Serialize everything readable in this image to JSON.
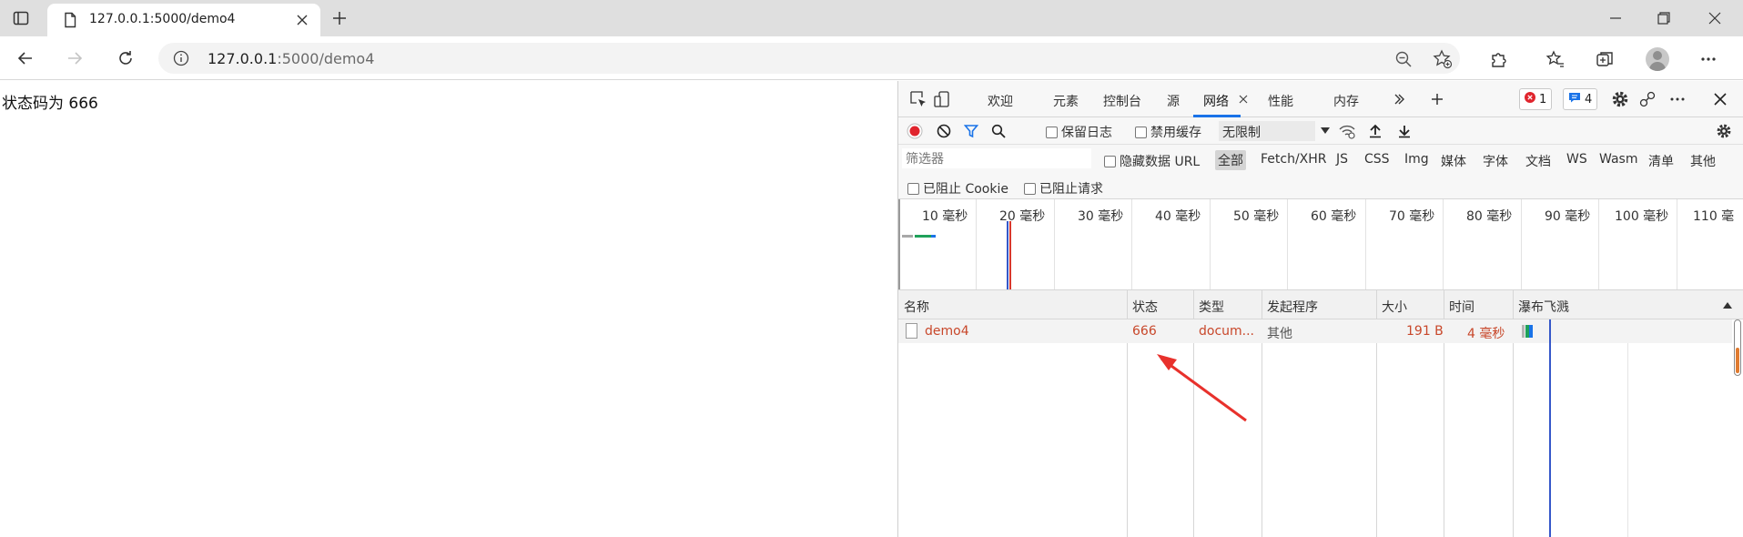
{
  "browser": {
    "tab_title": "127.0.0.1:5000/demo4",
    "url_host": "127.0.0.1",
    "url_path": ":5000/demo4"
  },
  "page": {
    "status_text": "状态码为 666"
  },
  "devtools": {
    "tabs": [
      "欢迎",
      "元素",
      "控制台",
      "源",
      "网络",
      "性能",
      "内存"
    ],
    "active_tab": "网络",
    "error_count": "1",
    "message_count": "4",
    "toolbar": {
      "preserve_log": "保留日志",
      "disable_cache": "禁用缓存",
      "throttling": "无限制"
    },
    "filter": {
      "placeholder": "筛选器",
      "hide_data_urls": "隐藏数据 URL",
      "types": [
        "全部",
        "Fetch/XHR",
        "JS",
        "CSS",
        "Img",
        "媒体",
        "字体",
        "文档",
        "WS",
        "Wasm",
        "清单",
        "其他"
      ],
      "active_type": "全部",
      "blocked_cookies": "已阻止 Cookie",
      "blocked_requests": "已阻止请求"
    },
    "overview_ticks": [
      "10 毫秒",
      "20 毫秒",
      "30 毫秒",
      "40 毫秒",
      "50 毫秒",
      "60 毫秒",
      "70 毫秒",
      "80 毫秒",
      "90 毫秒",
      "100 毫秒",
      "110 毫"
    ],
    "columns": [
      "名称",
      "状态",
      "类型",
      "发起程序",
      "大小",
      "时间",
      "瀑布飞溅"
    ],
    "rows": [
      {
        "name": "demo4",
        "status": "666",
        "type": "docum...",
        "initiator": "其他",
        "size": "191 B",
        "time": "4 毫秒"
      }
    ],
    "colors": {
      "error_red": "#c8472a",
      "accent_blue": "#1a73e8",
      "record_red": "#e0242d",
      "waterfall_blue": "#3557c9",
      "annotation_arrow": "#e8312c"
    }
  }
}
